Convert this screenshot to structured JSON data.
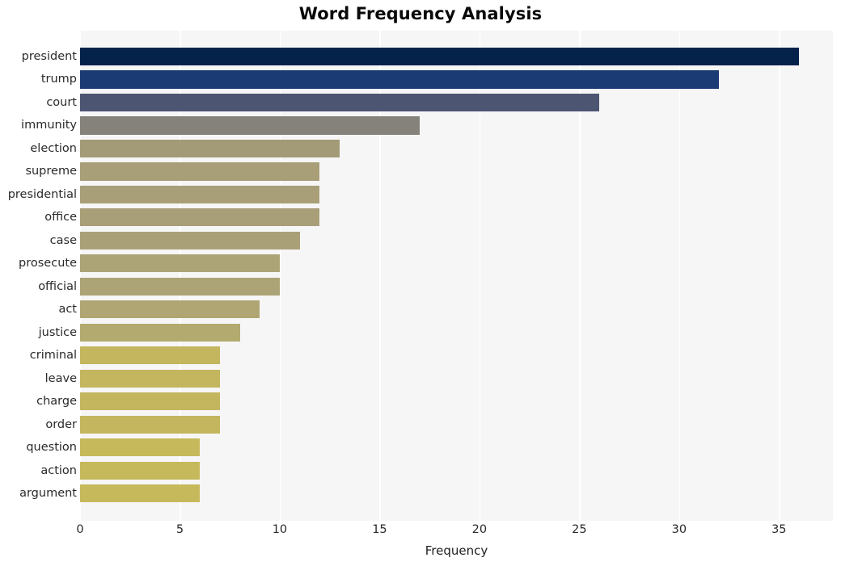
{
  "chart_data": {
    "type": "bar",
    "orientation": "horizontal",
    "title": "Word Frequency Analysis",
    "xlabel": "Frequency",
    "ylabel": "",
    "xlim": [
      0,
      37.7
    ],
    "xticks": [
      0,
      5,
      10,
      15,
      20,
      25,
      30,
      35
    ],
    "xtick_labels": [
      "0",
      "5",
      "10",
      "15",
      "20",
      "25",
      "30",
      "35"
    ],
    "grid": "vertical-white-on-gray",
    "legend": "none",
    "categories": [
      "president",
      "trump",
      "court",
      "immunity",
      "election",
      "supreme",
      "presidential",
      "office",
      "case",
      "prosecute",
      "official",
      "act",
      "justice",
      "criminal",
      "leave",
      "charge",
      "order",
      "question",
      "action",
      "argument"
    ],
    "values": [
      36,
      32,
      26,
      17,
      13,
      12,
      12,
      12,
      11,
      10,
      10,
      9,
      8,
      7,
      7,
      7,
      7,
      6,
      6,
      6
    ],
    "bar_colors": [
      "#05224b",
      "#1b3b74",
      "#4c5572",
      "#85827c",
      "#a39a78",
      "#a89e77",
      "#a89e77",
      "#a89e77",
      "#aaa077",
      "#aca376",
      "#aca376",
      "#afa673",
      "#b3aa6f",
      "#c3b65e",
      "#c3b65e",
      "#c3b65e",
      "#c3b65e",
      "#c6b95b",
      "#c6b95b",
      "#c6b95b"
    ],
    "plot_background": "#f6f6f7",
    "figure_background": "#ffffff",
    "gridline_color": "#ffffff",
    "title_color": "#0a0a0a",
    "tick_color": "#2a2a2a"
  }
}
